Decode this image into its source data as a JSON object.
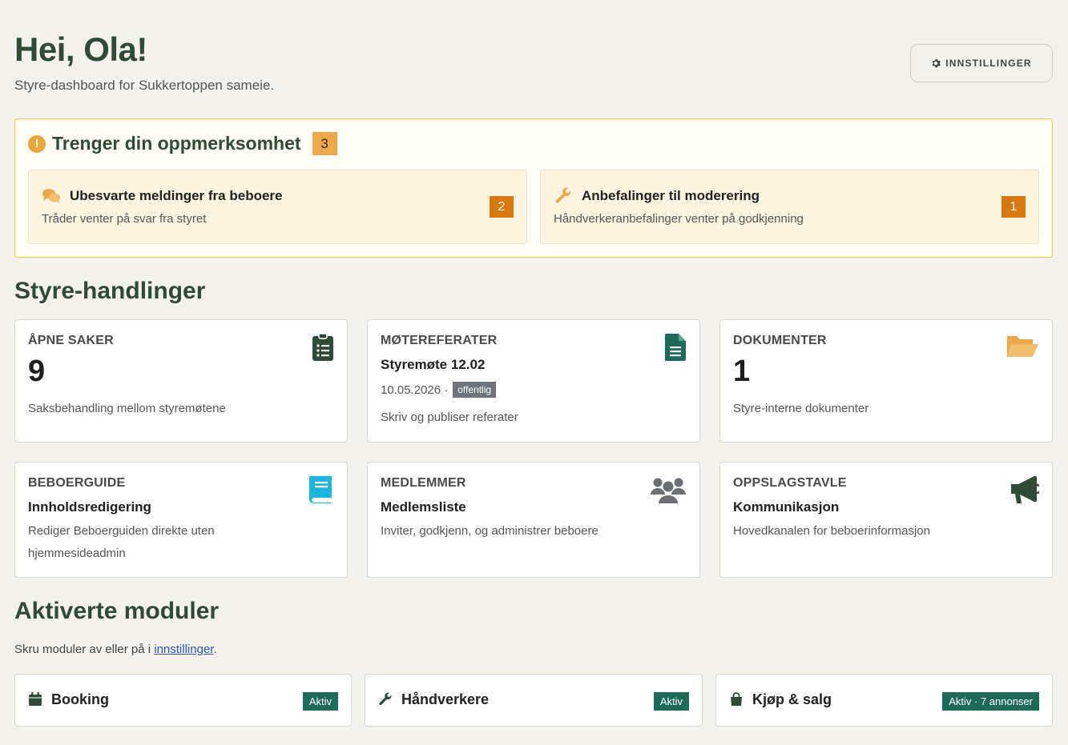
{
  "header": {
    "greeting": "Hei, Ola!",
    "subtitle": "Styre-dashboard for Sukkertoppen sameie.",
    "settings_label": "INNSTILLINGER",
    "settings_icon": "gear-icon"
  },
  "attention": {
    "title": "Trenger din oppmerksomhet",
    "count": "3",
    "icon": "exclamation-circle-icon",
    "accent": "#efca48",
    "items": [
      {
        "title": "Ubesvarte meldinger fra beboere",
        "desc": "Tråder venter på svar fra styret",
        "count": "2",
        "icon": "chat-bubbles-icon"
      },
      {
        "title": "Anbefalinger til moderering",
        "desc": "Håndverkeranbefalinger venter på godkjenning",
        "count": "1",
        "icon": "wrench-icon"
      }
    ]
  },
  "actions": {
    "title": "Styre-handlinger",
    "cards": [
      {
        "label": "ÅPNE SAKER",
        "value": "9",
        "desc": "Saksbehandling mellom styremøtene",
        "icon": "clipboard-list-icon"
      },
      {
        "label": "MØTEREFERATER",
        "sub": "Styremøte 12.02",
        "date": "10.05.2026 ·",
        "tag": "offentlig",
        "desc": "Skriv og publiser referater",
        "icon": "document-icon"
      },
      {
        "label": "DOKUMENTER",
        "value": "1",
        "desc": "Styre-interne dokumenter",
        "icon": "folder-open-icon"
      },
      {
        "label": "BEBOERGUIDE",
        "sub": "Innholdsredigering",
        "desc": "Rediger Beboerguiden direkte uten hjemmesideadmin",
        "icon": "book-icon"
      },
      {
        "label": "MEDLEMMER",
        "sub": "Medlemsliste",
        "desc": "Inviter, godkjenn, og administrer beboere",
        "icon": "users-icon"
      },
      {
        "label": "OPPSLAGSTAVLE",
        "sub": "Kommunikasjon",
        "desc": "Hovedkanalen for beboerinformasjon",
        "icon": "megaphone-icon"
      }
    ]
  },
  "modules": {
    "title": "Aktiverte moduler",
    "hint_prefix": "Skru moduler av eller på i ",
    "hint_link": "innstillinger",
    "hint_suffix": ".",
    "items": [
      {
        "name": "Booking",
        "badge": "Aktiv",
        "icon": "calendar-icon"
      },
      {
        "name": "Håndverkere",
        "badge": "Aktiv",
        "icon": "wrench-icon"
      },
      {
        "name": "Kjøp & salg",
        "badge": "Aktiv · 7 annonser",
        "icon": "shopping-bag-icon"
      }
    ]
  },
  "colors": {
    "brand_green": "#2f4a35",
    "badge_green": "#1f6b5b",
    "orange": "#d9780f",
    "page_bg": "#f4f2ed"
  }
}
